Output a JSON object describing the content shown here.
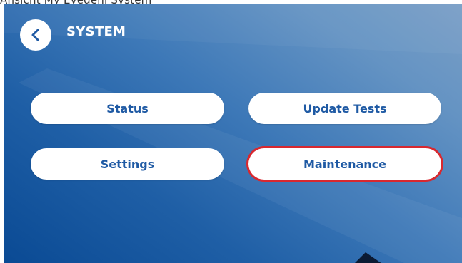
{
  "caption": "Ansicht My Eyegeni System",
  "header": {
    "title": "SYSTEM",
    "back_icon": "chevron-left-icon"
  },
  "menu": {
    "status": "Status",
    "update_tests": "Update Tests",
    "settings": "Settings",
    "maintenance": "Maintenance",
    "selected": "maintenance"
  },
  "colors": {
    "background_dark": "#0a4a94",
    "background_light": "#7a9fc6",
    "button_text": "#1f5aa4",
    "selected_outline": "#d8282f"
  }
}
